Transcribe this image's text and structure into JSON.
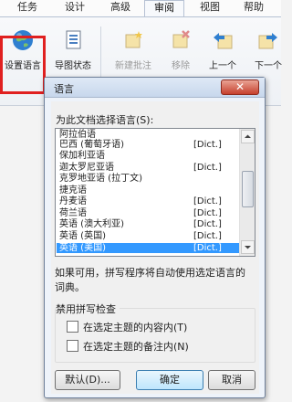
{
  "ribbon": {
    "tabs": [
      "任务",
      "设计",
      "高级",
      "审阅",
      "视图",
      "帮助"
    ],
    "active_tab": "审阅",
    "buttons": [
      {
        "label": "设置语言",
        "icon": "globe-icon",
        "disabled": false
      },
      {
        "label": "导图状态",
        "icon": "status-icon",
        "disabled": false
      },
      {
        "label": "新建批注",
        "icon": "new-comment-icon",
        "disabled": true
      },
      {
        "label": "移除",
        "icon": "remove-comment-icon",
        "disabled": true
      },
      {
        "label": "上一个",
        "icon": "previous-icon",
        "disabled": false
      },
      {
        "label": "下一个",
        "icon": "next-icon",
        "disabled": false
      }
    ]
  },
  "dialog": {
    "title": "语言",
    "close": "✕",
    "prompt": "为此文档选择语言(S):",
    "languages": [
      {
        "name": "阿拉伯语",
        "dict": ""
      },
      {
        "name": "巴西 (葡萄牙语)",
        "dict": "[Dict.]"
      },
      {
        "name": "保加利亚语",
        "dict": ""
      },
      {
        "name": "迦太罗尼亚语",
        "dict": "[Dict.]"
      },
      {
        "name": "克罗地亚语 (拉丁文)",
        "dict": ""
      },
      {
        "name": "捷克语",
        "dict": ""
      },
      {
        "name": "丹麦语",
        "dict": "[Dict.]"
      },
      {
        "name": "荷兰语",
        "dict": "[Dict.]"
      },
      {
        "name": "英语 (澳大利亚)",
        "dict": "[Dict.]"
      },
      {
        "name": "英语 (英国)",
        "dict": "[Dict.]"
      },
      {
        "name": "英语 (美国)",
        "dict": "[Dict.]"
      }
    ],
    "selected_index": 10,
    "note": "如果可用，拼写程序将自动使用选定语言的词典。",
    "group_title": "禁用拼写检查",
    "checkboxes": [
      "在选定主题的内容内(T)",
      "在选定主题的备注内(N)"
    ],
    "buttons": {
      "default": "默认(D)...",
      "ok": "确定",
      "cancel": "取消"
    }
  },
  "colors": {
    "selection": "#3399ff",
    "highlight": "#e02020"
  }
}
